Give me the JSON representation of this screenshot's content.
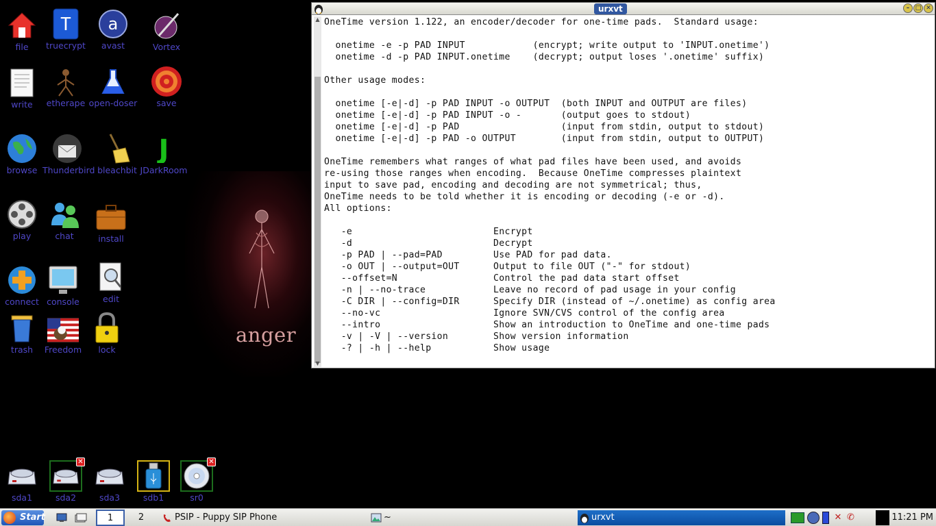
{
  "desktop": {
    "wallpaper_text": "anger",
    "icons": [
      {
        "label": "file",
        "icon": "home-icon"
      },
      {
        "label": "truecrypt",
        "icon": "truecrypt-icon"
      },
      {
        "label": "avast",
        "icon": "avast-icon"
      },
      {
        "label": "Vortex",
        "icon": "vortex-icon"
      },
      {
        "label": "write",
        "icon": "document-icon"
      },
      {
        "label": "etherape",
        "icon": "etherape-icon"
      },
      {
        "label": "open-doser",
        "icon": "flask-icon"
      },
      {
        "label": "save",
        "icon": "target-icon"
      },
      {
        "label": "browse",
        "icon": "globe-icon"
      },
      {
        "label": "Thunderbird",
        "icon": "thunderbird-icon"
      },
      {
        "label": "bleachbit",
        "icon": "broom-icon"
      },
      {
        "label": "JDarkRoom",
        "icon": "jdarkroom-icon"
      },
      {
        "label": "play",
        "icon": "film-reel-icon"
      },
      {
        "label": "chat",
        "icon": "users-icon"
      },
      {
        "label": "install",
        "icon": "briefcase-icon"
      },
      {
        "label": "connect",
        "icon": "connect-icon"
      },
      {
        "label": "console",
        "icon": "monitor-icon"
      },
      {
        "label": "edit",
        "icon": "magnifier-doc-icon"
      },
      {
        "label": "trash",
        "icon": "trash-icon"
      },
      {
        "label": "Freedom",
        "icon": "eagle-flag-icon"
      },
      {
        "label": "lock",
        "icon": "padlock-icon"
      }
    ],
    "drives": [
      {
        "label": "sda1",
        "mounted": false
      },
      {
        "label": "sda2",
        "mounted": true
      },
      {
        "label": "sda3",
        "mounted": false
      },
      {
        "label": "sdb1",
        "mounted": false
      },
      {
        "label": "sr0",
        "mounted": true
      }
    ]
  },
  "terminal": {
    "title": "urxvt",
    "text": "OneTime version 1.122, an encoder/decoder for one-time pads.  Standard usage:\n\n  onetime -e -p PAD INPUT            (encrypt; write output to 'INPUT.onetime')\n  onetime -d -p PAD INPUT.onetime    (decrypt; output loses '.onetime' suffix)\n\nOther usage modes:\n\n  onetime [-e|-d] -p PAD INPUT -o OUTPUT  (both INPUT and OUTPUT are files)\n  onetime [-e|-d] -p PAD INPUT -o -       (output goes to stdout)\n  onetime [-e|-d] -p PAD                  (input from stdin, output to stdout)\n  onetime [-e|-d] -p PAD -o OUTPUT        (input from stdin, output to OUTPUT)\n\nOneTime remembers what ranges of what pad files have been used, and avoids\nre-using those ranges when encoding.  Because OneTime compresses plaintext\ninput to save pad, encoding and decoding are not symmetrical; thus,\nOneTime needs to be told whether it is encoding or decoding (-e or -d).\nAll options:\n\n   -e                         Encrypt\n   -d                         Decrypt\n   -p PAD | --pad=PAD         Use PAD for pad data.\n   -o OUT | --output=OUT      Output to file OUT (\"-\" for stdout)\n   --offset=N                 Control the pad data start offset\n   -n | --no-trace            Leave no record of pad usage in your config\n   -C DIR | --config=DIR      Specify DIR (instead of ~/.onetime) as config area\n   --no-vc                    Ignore SVN/CVS control of the config area\n   --intro                    Show an introduction to OneTime and one-time pads\n   -v | -V | --version        Show version information\n   -? | -h | --help           Show usage"
  },
  "taskbar": {
    "start_label": "Start",
    "workspaces": [
      "1",
      "2"
    ],
    "tasks": [
      {
        "label": "PSIP - Puppy SIP Phone",
        "icon": "phone-icon"
      },
      {
        "label": "~",
        "icon": "image-icon"
      },
      {
        "label": "urxvt",
        "icon": "tux-icon"
      }
    ],
    "clock": "11:21 PM"
  }
}
